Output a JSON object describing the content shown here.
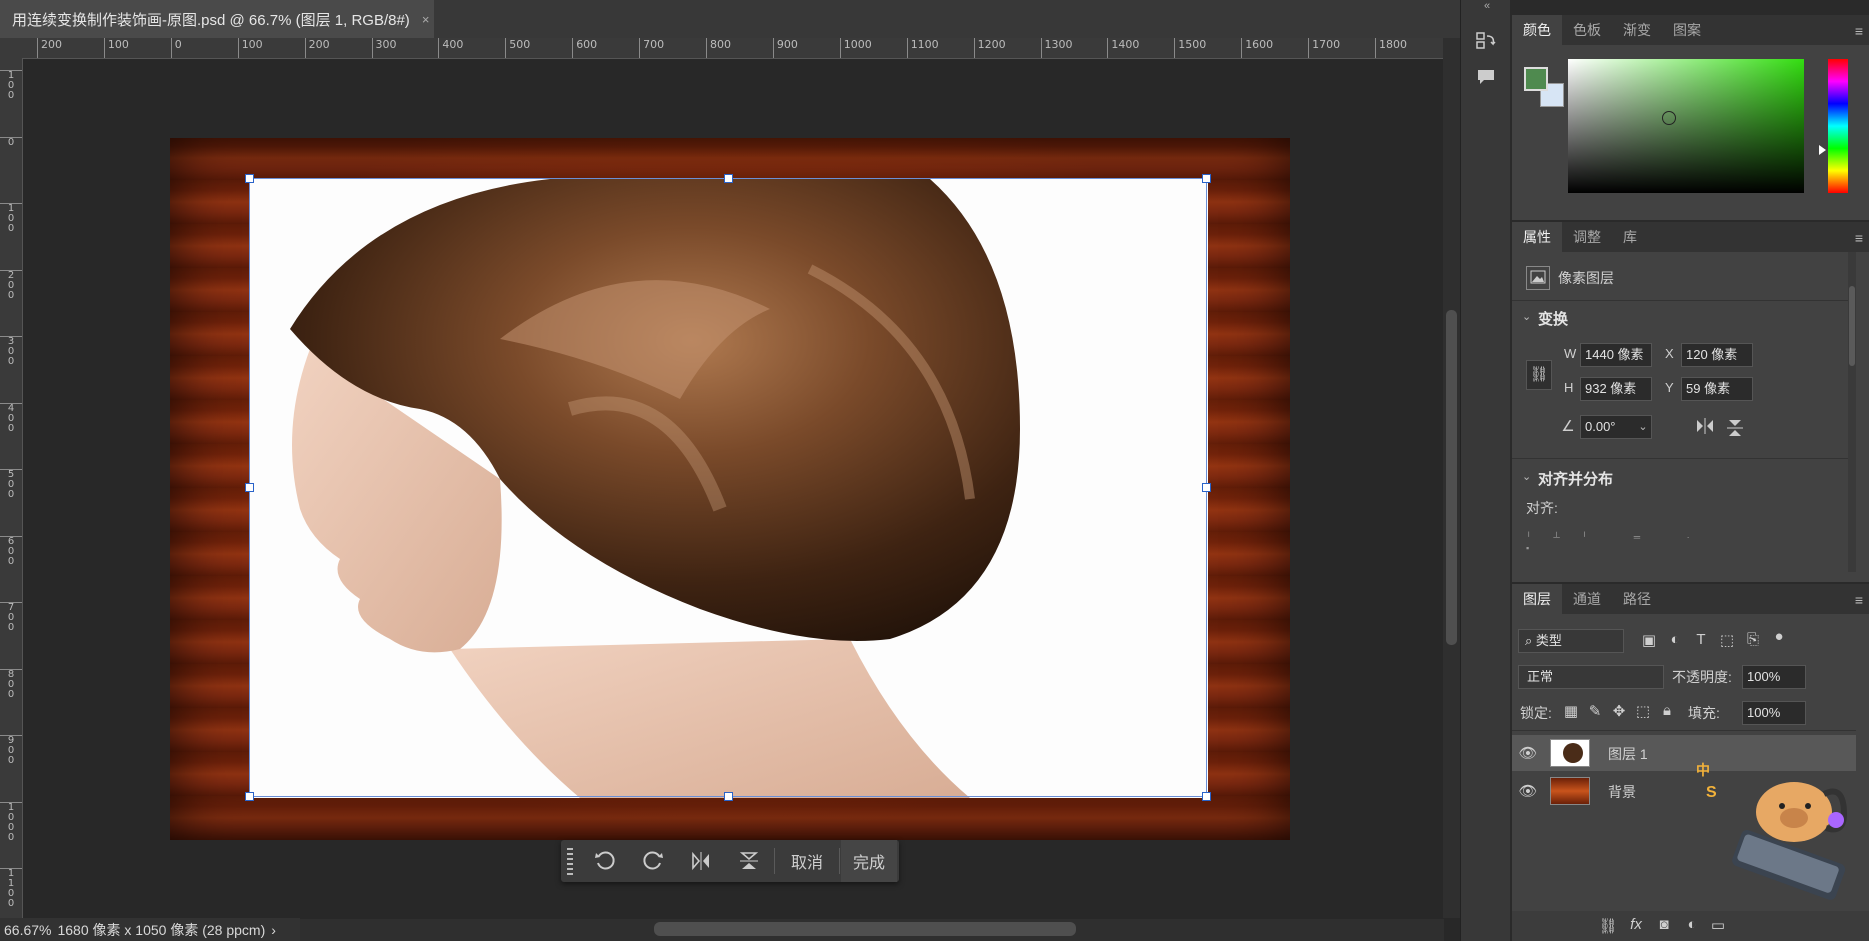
{
  "document": {
    "tab_title": "用连续变换制作装饰画-原图.psd @ 66.7% (图层 1, RGB/8#)",
    "tab_close": "×",
    "ruler_h_labels": [
      "200",
      "100",
      "0",
      "100",
      "200",
      "300",
      "400",
      "500",
      "600",
      "700",
      "800",
      "900",
      "1000",
      "1100",
      "1200",
      "1300",
      "1400",
      "1500",
      "1600",
      "1700",
      "1800"
    ],
    "ruler_v_labels": [
      "1 0 0",
      "0",
      "1 0 0",
      "2 0 0",
      "3 0 0",
      "4 0 0",
      "5 0 0",
      "6 0 0",
      "7 0 0",
      "8 0 0",
      "9 0 0",
      "1 0 0 0",
      "1 1 0 0"
    ]
  },
  "status": {
    "zoom": "66.67%",
    "info": "1680 像素 x 1050 像素 (28 ppcm)",
    "arrow": "›"
  },
  "transform_bar": {
    "cancel": "取消",
    "done": "完成"
  },
  "color_panel": {
    "tabs": [
      "颜色",
      "色板",
      "渐变",
      "图案"
    ],
    "foreground": "#4f8a4f",
    "background": "#d7e5f5",
    "hue": "#33dd11"
  },
  "properties_panel": {
    "tabs": [
      "属性",
      "调整",
      "库"
    ],
    "layer_type": "像素图层",
    "transform_title": "变换",
    "w_label": "W",
    "w_value": "1440 像素",
    "h_label": "H",
    "h_value": "932 像素",
    "x_label": "X",
    "x_value": "120 像素",
    "y_label": "Y",
    "y_value": "59 像素",
    "angle_value": "0.00°",
    "align_title": "对齐并分布",
    "align_label": "对齐:"
  },
  "layers_panel": {
    "tabs": [
      "图层",
      "通道",
      "路径"
    ],
    "filter_kind": "类型",
    "blend_mode": "正常",
    "opacity_label": "不透明度:",
    "opacity_value": "100%",
    "lock_label": "锁定:",
    "fill_label": "填充:",
    "fill_value": "100%",
    "layers": [
      {
        "name": "图层 1",
        "selected": true
      },
      {
        "name": "背景",
        "selected": false
      }
    ],
    "footer_fx": "fx"
  },
  "mascot": {
    "badge_1": "中",
    "badge_2": "S"
  }
}
